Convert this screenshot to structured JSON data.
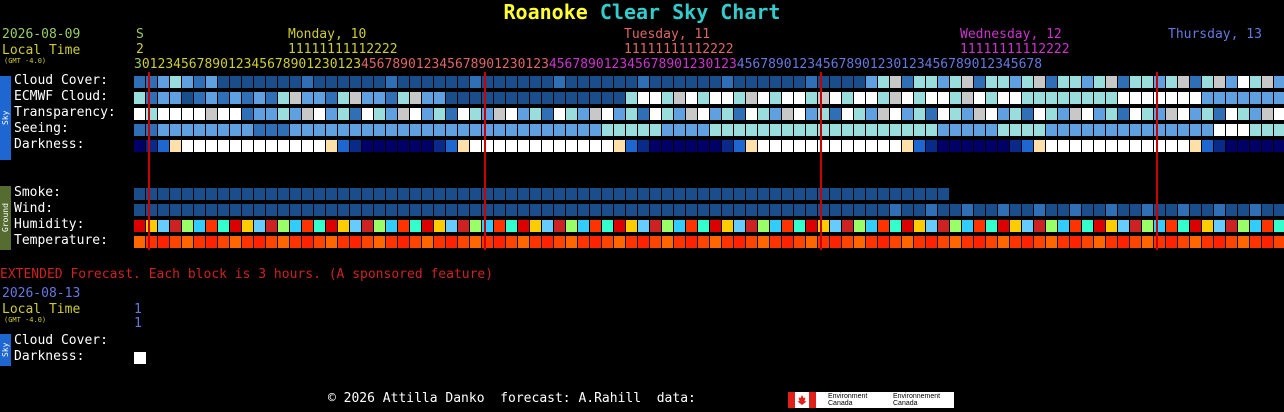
{
  "title": {
    "site": "Roanoke",
    "rest": "Clear Sky Chart"
  },
  "header": {
    "date": "2026-08-09",
    "local_time": "Local Time",
    "gmt": "(GMT -4.0)",
    "first_day_initial": "S",
    "first_day_digit": "2",
    "days": [
      {
        "label": "Monday, 10",
        "color": "#cccc33"
      },
      {
        "label": "Tuesday, 11",
        "color": "#dd6666"
      },
      {
        "label": "Wednesday, 12",
        "color": "#cc33cc"
      },
      {
        "label": "Thursday, 13",
        "color": "#6677dd"
      }
    ],
    "tens_row": "11111111111112222",
    "hours_row": "30123456789012345678901230123456789012345678901230123456789012345678901230123456789012345678901230123456789012345678",
    "tens_line": "11111111112222"
  },
  "sky_section": {
    "side_label": "Sky",
    "rows": [
      {
        "label": "Cloud Cover:"
      },
      {
        "label": "ECMWF Cloud:"
      },
      {
        "label": "Transparency:"
      },
      {
        "label": "Seeing:"
      },
      {
        "label": "Darkness:"
      }
    ]
  },
  "ground_section": {
    "side_label": "Ground",
    "rows": [
      {
        "label": "Smoke:"
      },
      {
        "label": "Wind:"
      },
      {
        "label": "Humidity:"
      },
      {
        "label": "Temperature:"
      }
    ]
  },
  "extended": {
    "notice": "EXTENDED Forecast. Each block is 3 hours. (A sponsored feature)",
    "date": "2026-08-13",
    "local_time": "Local Time",
    "gmt": "(GMT -4.0)",
    "hour_tens": "1",
    "hour_ones": "1",
    "side_label": "Sky",
    "rows": [
      {
        "label": "Cloud Cover:"
      },
      {
        "label": "Darkness:"
      }
    ]
  },
  "footer": {
    "credit": "© 2026 Attilla Danko  forecast: A.Rahill  data:",
    "logo_en": "Environment Canada",
    "logo_fr": "Environnement Canada"
  },
  "colors": {
    "dark_blue": "#1a4e8a",
    "mid_blue": "#2f6fb6",
    "light_blue": "#5fa0e0",
    "pale_cyan": "#99dddd",
    "white": "#ffffff",
    "grey": "#c8c8c8",
    "navy": "#000066",
    "night_blue": "#0a2a8a",
    "dusk_blue": "#1e66d0",
    "peach": "#ffe0a8",
    "red_line": "#cc0000"
  }
}
